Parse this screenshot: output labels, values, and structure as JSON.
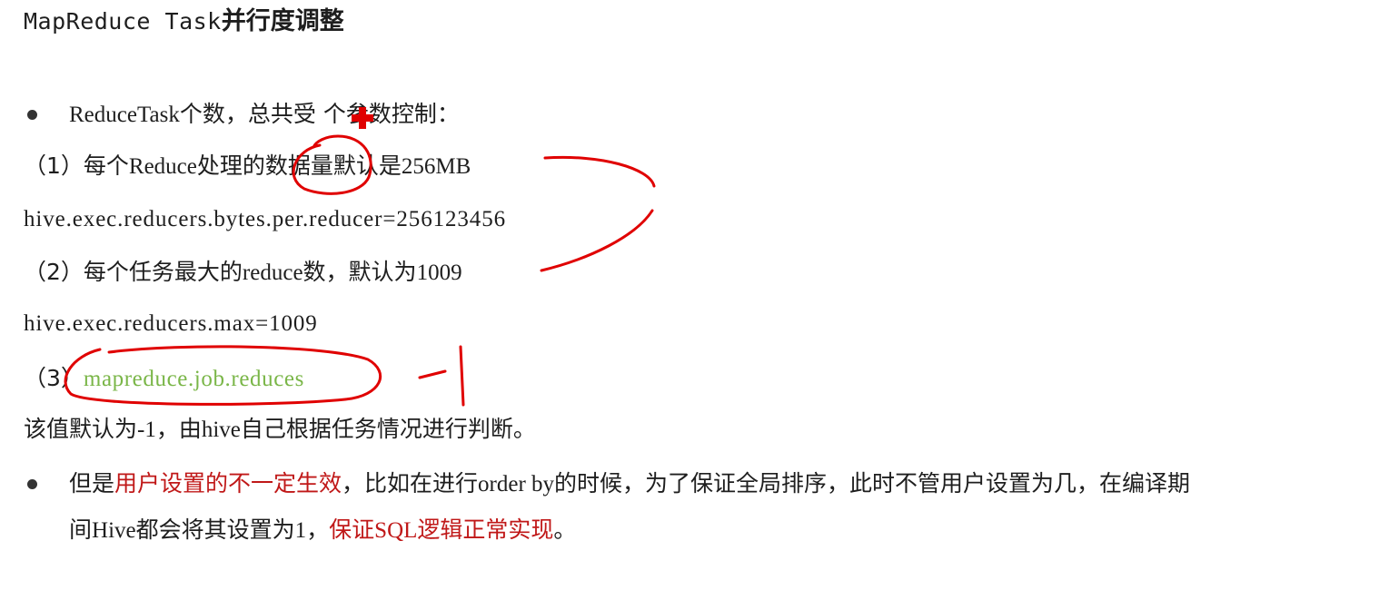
{
  "title": {
    "mono": "MapReduce Task",
    "cn": "并行度调整"
  },
  "bullet1": {
    "a": "ReduceTask",
    "b": "个数，总共受",
    "c": "个参数控制："
  },
  "item1": {
    "a": "（1）每个",
    "b": "Reduce",
    "c": "处理的数据量默认是",
    "d": "256MB"
  },
  "code1": "hive.exec.reducers.bytes.per.reducer=256123456",
  "item2": {
    "a": "（2）每个任务最大的",
    "b": "reduce",
    "c": "数，默认为",
    "d": "1009"
  },
  "code2": "hive.exec.reducers.max=1009",
  "item3": {
    "a": "（3）",
    "b": "mapreduce.job.reduces"
  },
  "note": {
    "a": "该值默认为",
    "b": "-1",
    "c": "，由",
    "d": "hive",
    "e": "自己根据任务情况进行判断。"
  },
  "bullet2": {
    "l1a": "但是",
    "l1b": "用户设置的不一定生效",
    "l1c": "，比如在进行",
    "l1d": "order by",
    "l1e": "的时候，为了保证全局排序，此时不管用户设置为几，在编译期",
    "l2a": "间",
    "l2b": "Hive",
    "l2c": "都会将其设置为",
    "l2d": "1",
    "l2e": "，",
    "l2f": "保证",
    "l2g": "SQL",
    "l2h": "逻辑正常实现",
    "l2i": "。"
  },
  "colors": {
    "text": "#1e1e1e",
    "emphasis_red": "#c01818",
    "code_green": "#7ab648",
    "annotation_red": "#e00000"
  }
}
